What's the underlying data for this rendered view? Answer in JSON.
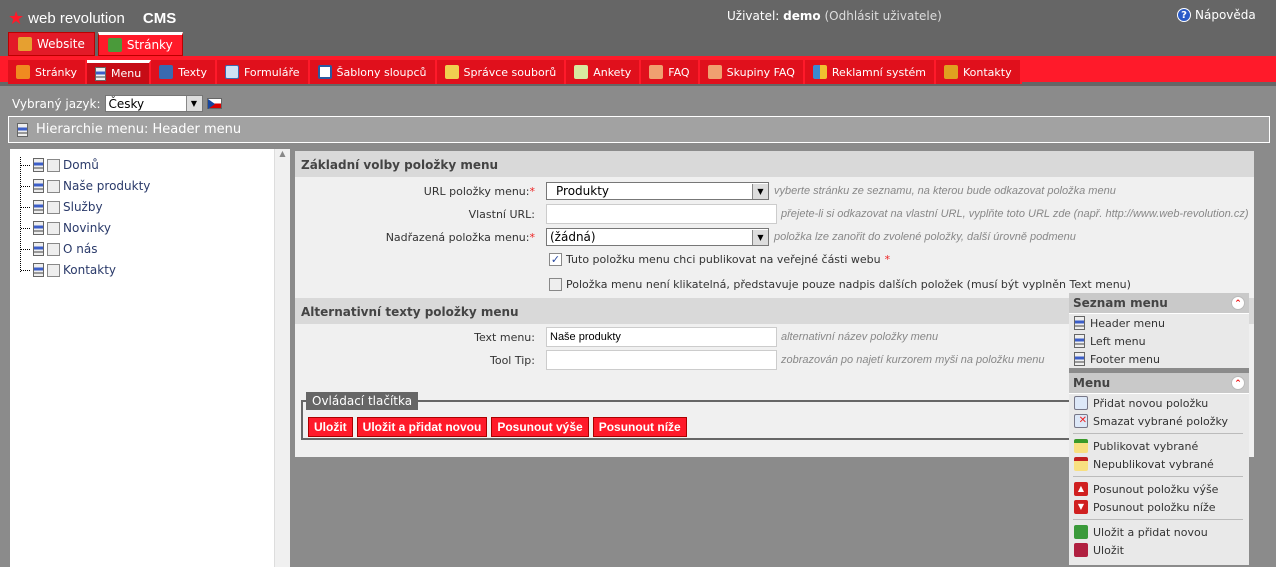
{
  "header": {
    "logo_text": "web revolution",
    "app": "CMS",
    "user_label": "Uživatel:",
    "user": "demo",
    "logout": "(Odhlásit uživatele)",
    "help": "Nápověda"
  },
  "tabs": [
    {
      "label": "Website"
    },
    {
      "label": "Stránky",
      "active": true
    }
  ],
  "nav": [
    {
      "label": "Stránky"
    },
    {
      "label": "Menu",
      "active": true
    },
    {
      "label": "Texty"
    },
    {
      "label": "Formuláře"
    },
    {
      "label": "Šablony sloupců"
    },
    {
      "label": "Správce souborů"
    },
    {
      "label": "Ankety"
    },
    {
      "label": "FAQ"
    },
    {
      "label": "Skupiny FAQ"
    },
    {
      "label": "Reklamní systém"
    },
    {
      "label": "Kontakty"
    }
  ],
  "language": {
    "label": "Vybraný jazyk:",
    "value": "Česky"
  },
  "hierarchy_title": "Hierarchie menu: Header menu",
  "tree": [
    "Domů",
    "Naše produkty",
    "Služby",
    "Novinky",
    "O nás",
    "Kontakty"
  ],
  "form": {
    "section1": "Základní volby položky menu",
    "url_label": "URL položky menu:",
    "url_value": "Produkty",
    "url_hint": "vyberte stránku ze seznamu, na kterou bude odkazovat položka menu",
    "custom_label": "Vlastní URL:",
    "custom_value": "",
    "custom_hint": "přejete-li si odkazovat na vlastní URL, vyplňte toto URL zde (např. http://www.web-revolution.cz)",
    "parent_label": "Nadřazená položka menu:",
    "parent_value": "(žádná)",
    "parent_hint": "položka lze zanořit do zvolené položky, další úrovně podmenu",
    "publish_label": "Tuto položku menu chci publikovat na veřejné části webu",
    "publish_checked": true,
    "notclick_label": "Položka menu není klikatelná, představuje pouze nadpis dalších položek (musí být vyplněn Text menu)",
    "notclick_checked": false,
    "section2": "Alternativní texty položky menu",
    "text_label": "Text menu:",
    "text_value": "Naše produkty",
    "text_hint": "alternativní název položky menu",
    "tooltip_label": "Tool Tip:",
    "tooltip_value": "",
    "tooltip_hint": "zobrazován po najetí kurzorem myši na položku menu",
    "controls_legend": "Ovládací tlačítka",
    "buttons": [
      "Uložit",
      "Uložit a přidat novou",
      "Posunout výše",
      "Posunout níže"
    ]
  },
  "side": {
    "list_title": "Seznam menu",
    "lists": [
      "Header menu",
      "Left menu",
      "Footer menu"
    ],
    "menu_title": "Menu",
    "actions": [
      "Přidat novou položku",
      "Smazat vybrané položky",
      "Publikovat vybrané",
      "Nepublikovat vybrané",
      "Posunout položku výše",
      "Posunout položku níže",
      "Uložit a přidat novou",
      "Uložit"
    ]
  },
  "colors": {
    "accent": "#ff1a2a",
    "topbar": "#666666"
  }
}
